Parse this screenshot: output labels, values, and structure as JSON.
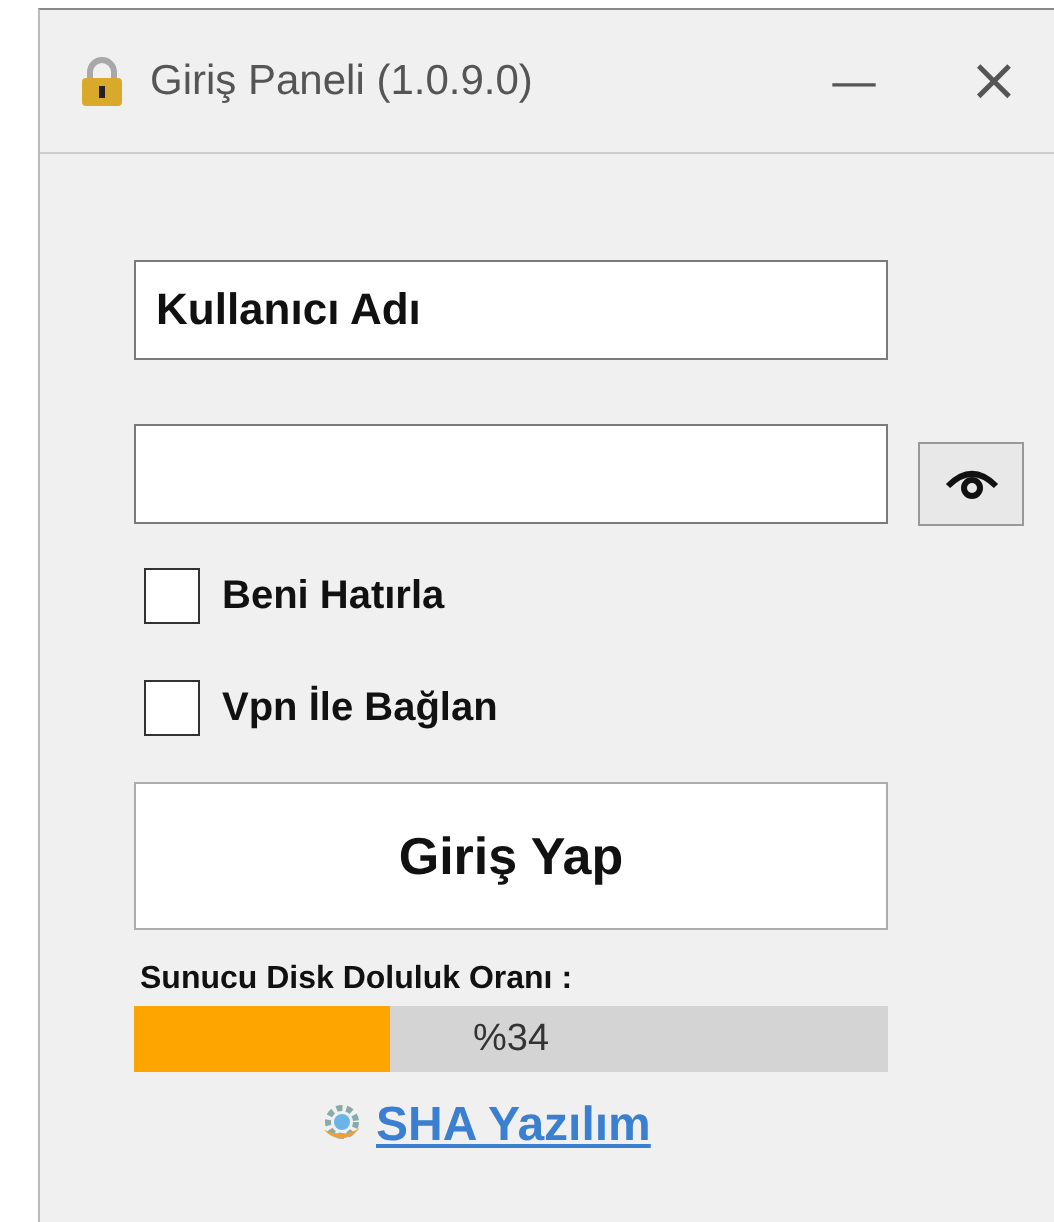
{
  "window": {
    "title": "Giriş Paneli (1.0.9.0)",
    "minimize": "—",
    "close": "×"
  },
  "username": {
    "value": "Kullanıcı Adı"
  },
  "checkboxes": [
    {
      "label": "Beni Hatırla",
      "checked": false
    },
    {
      "label": "Vpn İle Bağlan",
      "checked": false
    }
  ],
  "login_button": "Giriş Yap",
  "disk": {
    "label": "Sunucu Disk Doluluk Oranı :",
    "level": 0.34,
    "reading": "%34"
  },
  "link": "SHA Yazılım"
}
